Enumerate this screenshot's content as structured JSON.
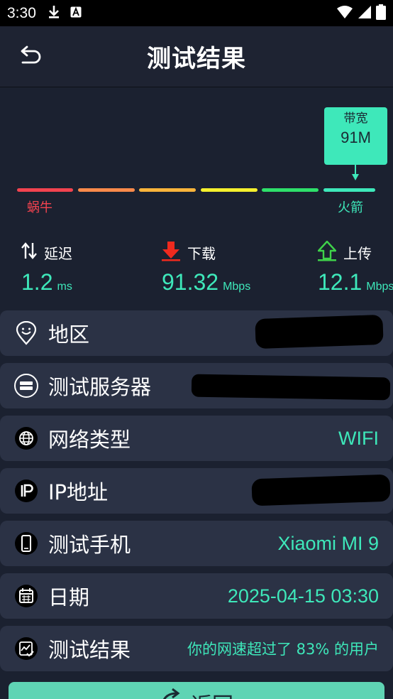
{
  "status_bar": {
    "time": "3:30",
    "icons": [
      "download-icon",
      "a-icon",
      "wifi-icon",
      "signal-icon",
      "battery-icon"
    ]
  },
  "app_bar": {
    "title": "测试结果",
    "back_icon": "back-arrow-icon"
  },
  "gauge": {
    "bubble_label": "带宽",
    "bubble_value": "91M",
    "left_label": "蜗牛",
    "right_label": "火箭",
    "segment_colors": [
      "#f2434f",
      "#f98a4a",
      "#f9b43b",
      "#f5f02d",
      "#2ee06a",
      "#3ee8ba"
    ],
    "position_fraction": 0.86
  },
  "metrics": {
    "latency": {
      "label": "延迟",
      "value": "1.2",
      "unit": "ms"
    },
    "download": {
      "label": "下载",
      "value": "91.32",
      "unit": "Mbps"
    },
    "upload": {
      "label": "上传",
      "value": "12.1",
      "unit": "Mbps"
    }
  },
  "rows": [
    {
      "label": "地区",
      "value": ""
    },
    {
      "label": "测试服务器",
      "value": ""
    },
    {
      "label": "网络类型",
      "value": "WIFI"
    },
    {
      "label": "IP地址",
      "value": ""
    },
    {
      "label": "测试手机",
      "value": "Xiaomi MI 9"
    },
    {
      "label": "日期",
      "value": "2025-04-15 03:30"
    },
    {
      "label": "测试结果",
      "value": "你的网速超过了 83% 的用户"
    }
  ],
  "return_button": {
    "label": "返回"
  },
  "colors": {
    "accent": "#3ee8ba",
    "background": "#1b2130",
    "row_background": "#2b3245",
    "download_red": "#f02a1e",
    "upload_green": "#3fd24a"
  }
}
